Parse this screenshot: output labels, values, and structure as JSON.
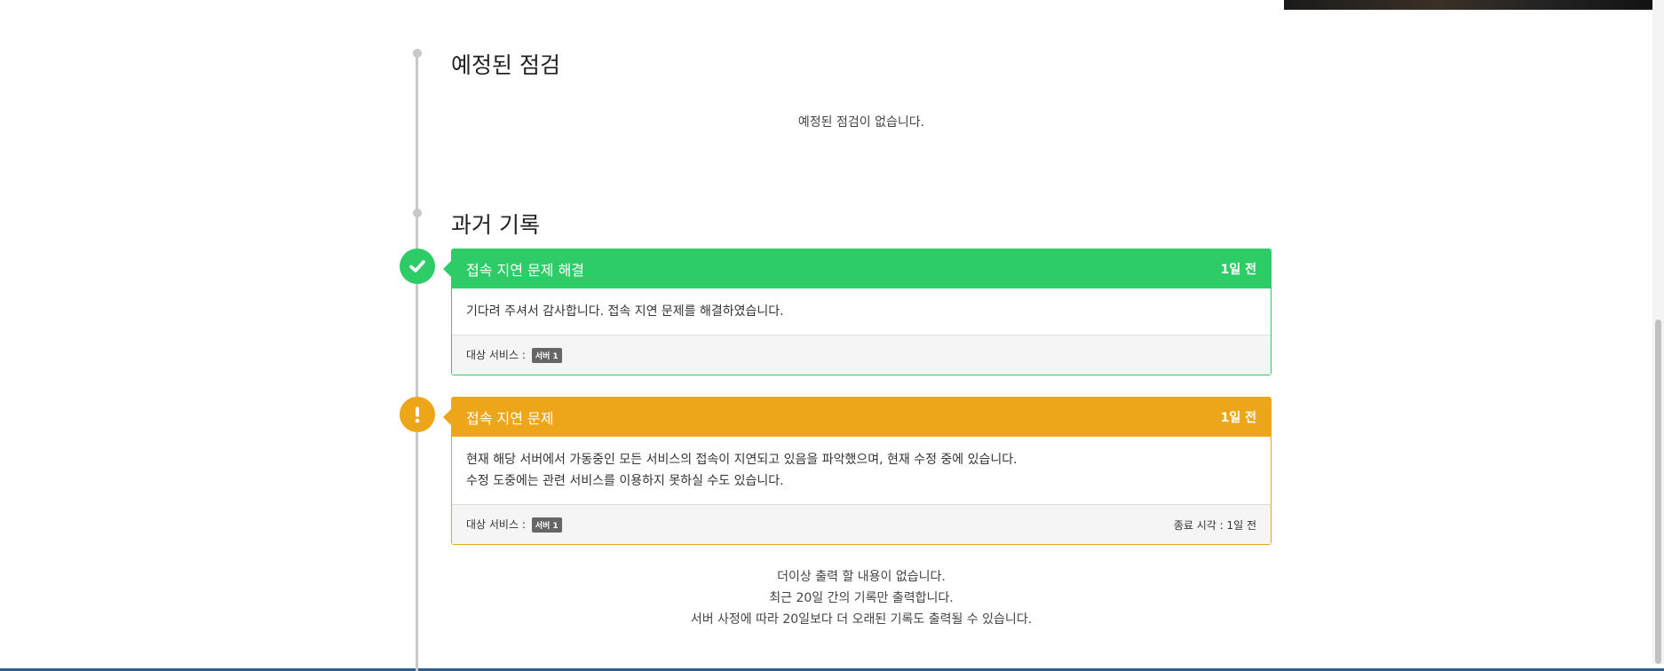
{
  "scheduled": {
    "title": "예정된 점검",
    "empty_text": "예정된 점검이 없습니다."
  },
  "history": {
    "title": "과거 기록",
    "incidents": [
      {
        "status": "resolved",
        "icon": "check-icon",
        "color": "#2ecc67",
        "title": "접속 지연 문제 해결",
        "time": "1일 전",
        "body": [
          "기다려 주셔서 감사합니다. 접속 지연 문제를 해결하였습니다."
        ],
        "footer_label": "대상 서비스 :",
        "service_badge": "서버 1",
        "end_time": ""
      },
      {
        "status": "warning",
        "icon": "exclamation-icon",
        "color": "#eda619",
        "title": "접속 지연 문제",
        "time": "1일 전",
        "body": [
          "현재 해당 서버에서 가동중인 모든 서비스의 접속이 지연되고 있음을 파악했으며, 현재 수정 중에 있습니다.",
          "수정 도중에는 관련 서비스를 이용하지 못하실 수도 있습니다."
        ],
        "footer_label": "대상 서비스 :",
        "service_badge": "서버 1",
        "end_time": "종료 시각 : 1일 전"
      }
    ]
  },
  "footer_notes": [
    "더이상 출력 할 내용이 없습니다.",
    "최근 20일 간의 기록만 출력합니다.",
    "서버 사정에 따라 20일보다 더 오래된 기록도 출력될 수 있습니다."
  ]
}
